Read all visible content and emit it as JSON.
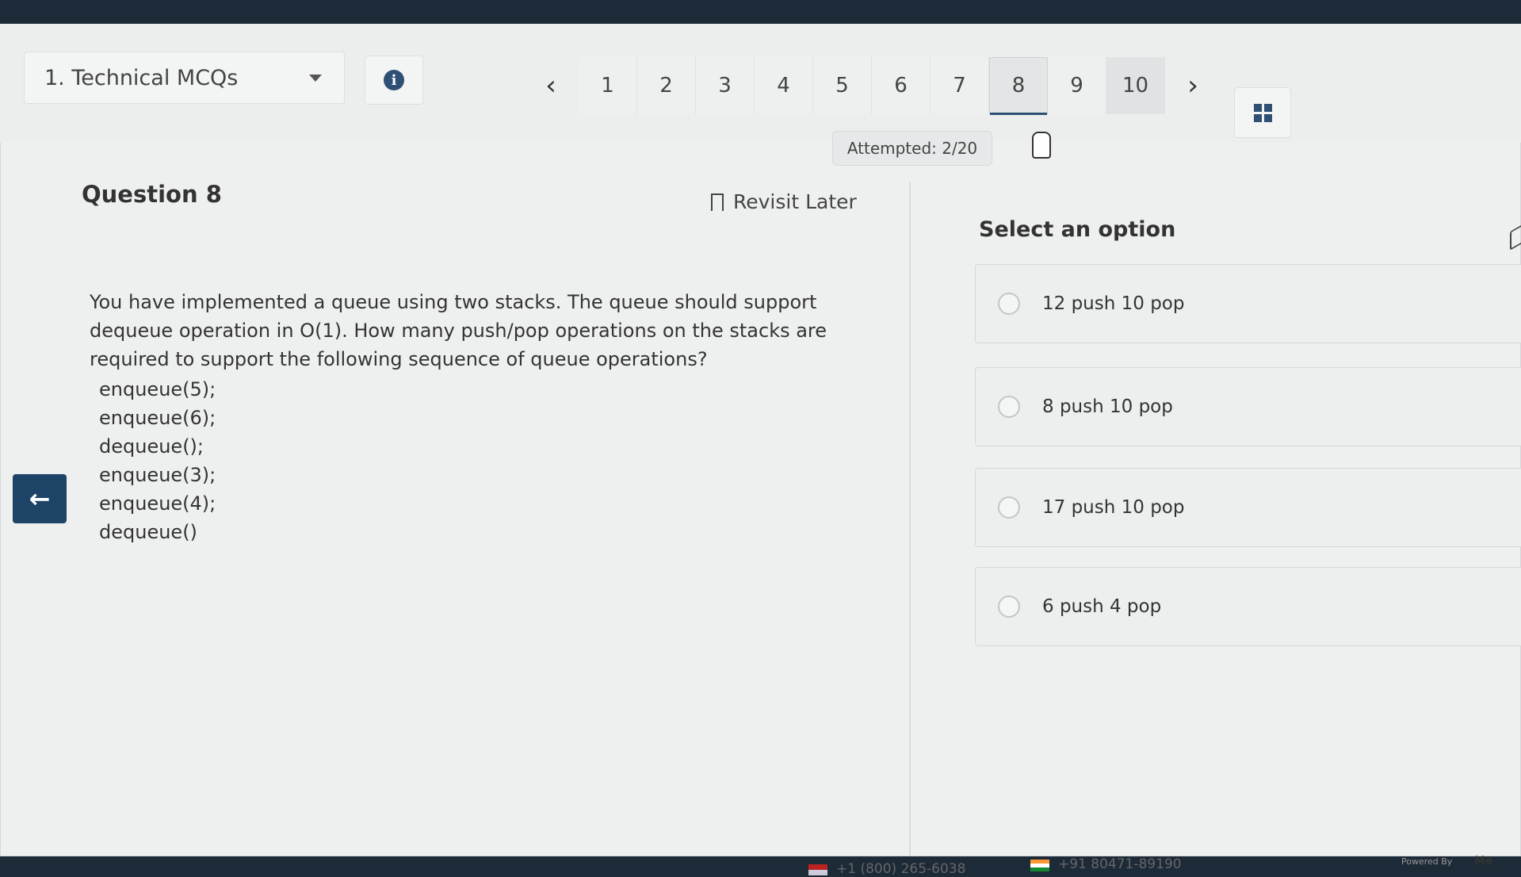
{
  "header": {
    "section_label": "1. Technical MCQs",
    "info_icon": "info-icon",
    "prev_icon": "chevron-left-icon",
    "next_icon": "chevron-right-icon",
    "pages": [
      "1",
      "2",
      "3",
      "4",
      "5",
      "6",
      "7",
      "8",
      "9",
      "10"
    ],
    "current_page": "8",
    "attempted": "Attempted: 2/20",
    "grid_icon": "grid-icon"
  },
  "question": {
    "title": "Question 8",
    "revisit_label": "Revisit Later",
    "text": "You have implemented a queue using two stacks. The queue should support dequeue operation in O(1). How many push/pop operations on the stacks are required to support the following sequence of queue operations?",
    "lines": [
      "enqueue(5);",
      "enqueue(6);",
      "dequeue();",
      "enqueue(3);",
      "enqueue(4);",
      "dequeue()"
    ]
  },
  "options": {
    "title": "Select an option",
    "items": [
      "12 push 10 pop",
      "8 push 10 pop",
      "17 push 10 pop",
      "6 push 4 pop"
    ]
  },
  "footer": {
    "phone_us": "+1 (800) 265-6038",
    "phone_in": "+91 80471-89190",
    "powered": "Powered By",
    "brand": "Me"
  },
  "colors": {
    "accent": "#1d4366",
    "background": "#eef0ef"
  }
}
